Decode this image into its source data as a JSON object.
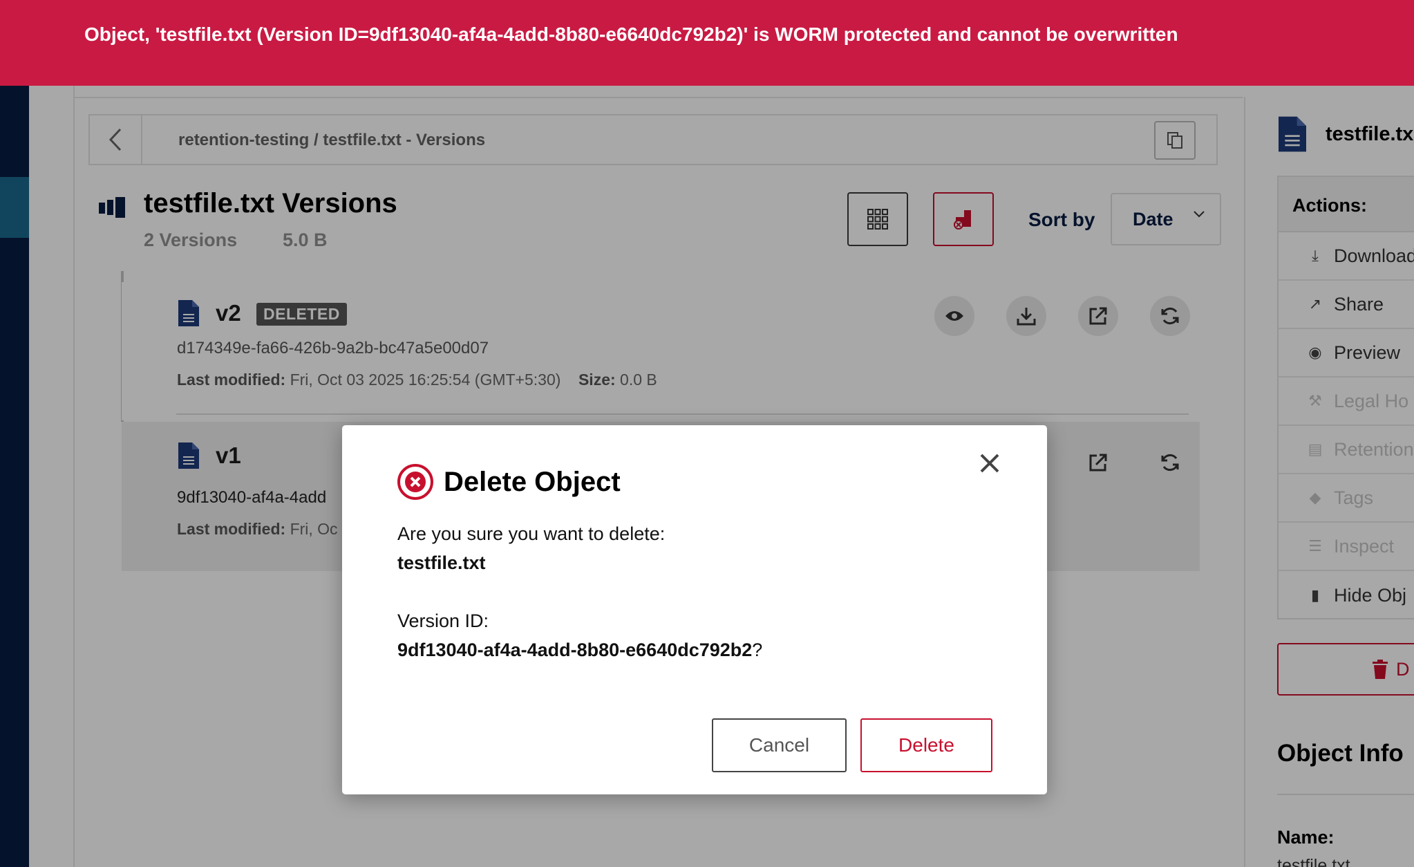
{
  "error_banner": {
    "message": "Object, 'testfile.txt (Version ID=9df13040-af4a-4add-8b80-e6640dc792b2)' is WORM protected and cannot be overwritten",
    "color": "#c91a43"
  },
  "breadcrumb": {
    "text": "retention-testing / testfile.txt - Versions"
  },
  "header": {
    "title": "testfile.txt Versions",
    "versions_count": "2 Versions",
    "total_size": "5.0 B",
    "sort_label": "Sort by",
    "sort_value": "Date"
  },
  "versions": [
    {
      "label": "v2",
      "badge": "DELETED",
      "id": "d174349e-fa66-426b-9a2b-bc47a5e00d07",
      "last_modified_label": "Last modified:",
      "last_modified": "Fri, Oct 03 2025 16:25:54 (GMT+5:30)",
      "size_label": "Size:",
      "size": "0.0 B"
    },
    {
      "label": "v1",
      "id_visible": "9df13040-af4a-4add",
      "last_modified_label": "Last modified:",
      "last_modified_visible": "Fri, Oc"
    }
  ],
  "right_panel": {
    "title": "testfile.tx",
    "actions_heading": "Actions:",
    "actions": [
      {
        "label": "Download",
        "icon": "download-icon",
        "enabled": true
      },
      {
        "label": "Share",
        "icon": "share-icon",
        "enabled": true
      },
      {
        "label": "Preview",
        "icon": "eye-icon",
        "enabled": true
      },
      {
        "label": "Legal Ho",
        "icon": "gavel-icon",
        "enabled": false
      },
      {
        "label": "Retention",
        "icon": "retention-icon",
        "enabled": false
      },
      {
        "label": "Tags",
        "icon": "tag-icon",
        "enabled": false
      },
      {
        "label": "Inspect",
        "icon": "inspect-icon",
        "enabled": false
      },
      {
        "label": "Hide Obj",
        "icon": "versions-icon",
        "enabled": true
      }
    ],
    "delete_label": "D",
    "info_title": "Object Info",
    "name_label": "Name:",
    "name_value": "testfile.txt"
  },
  "modal": {
    "title": "Delete Object",
    "question": "Are you sure you want to delete:",
    "object_name": "testfile.txt",
    "version_id_label": "Version ID:",
    "version_id": "9df13040-af4a-4add-8b80-e6640dc792b2",
    "question_mark": "?",
    "cancel_label": "Cancel",
    "delete_label": "Delete",
    "accent_color": "#c8102e"
  }
}
